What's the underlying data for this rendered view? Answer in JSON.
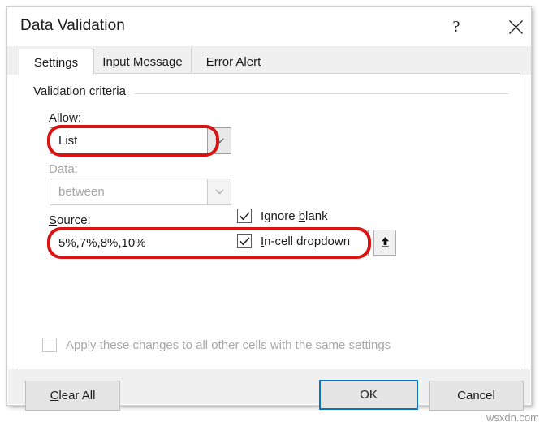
{
  "dialog": {
    "title": "Data Validation",
    "help_icon": "question-mark-icon",
    "close_icon": "close-x-icon"
  },
  "tabs": [
    {
      "label": "Settings",
      "active": true
    },
    {
      "label": "Input Message",
      "active": false
    },
    {
      "label": "Error Alert",
      "active": false
    }
  ],
  "settings": {
    "group_label": "Validation criteria",
    "allow": {
      "label_pre": "A",
      "label_accel": "A",
      "label": "Allow:",
      "value": "List",
      "arrow_icon": "chevron-down-icon",
      "highlighted": true
    },
    "data": {
      "label": "Data:",
      "value": "between",
      "arrow_icon": "chevron-down-icon",
      "disabled": true
    },
    "source": {
      "label": "Source:",
      "value": "5%,7%,8%,10%",
      "range_button_icon": "range-select-up-arrow-icon",
      "highlighted": true
    },
    "checkboxes": [
      {
        "label": "Ignore blank",
        "checked": true,
        "disabled": false
      },
      {
        "label": "In-cell dropdown",
        "checked": true,
        "disabled": false
      }
    ],
    "apply_all": {
      "label": "Apply these changes to all other cells with the same settings",
      "checked": false,
      "disabled": true
    }
  },
  "footer": {
    "clear_all": "Clear All",
    "ok": "OK",
    "cancel": "Cancel"
  },
  "watermark": "wsxdn.com",
  "colors": {
    "annotation_red": "#d81313",
    "focus_blue": "#0a74c4",
    "dialog_bg": "#ffffff",
    "panel_bg": "#f0f0f0"
  }
}
